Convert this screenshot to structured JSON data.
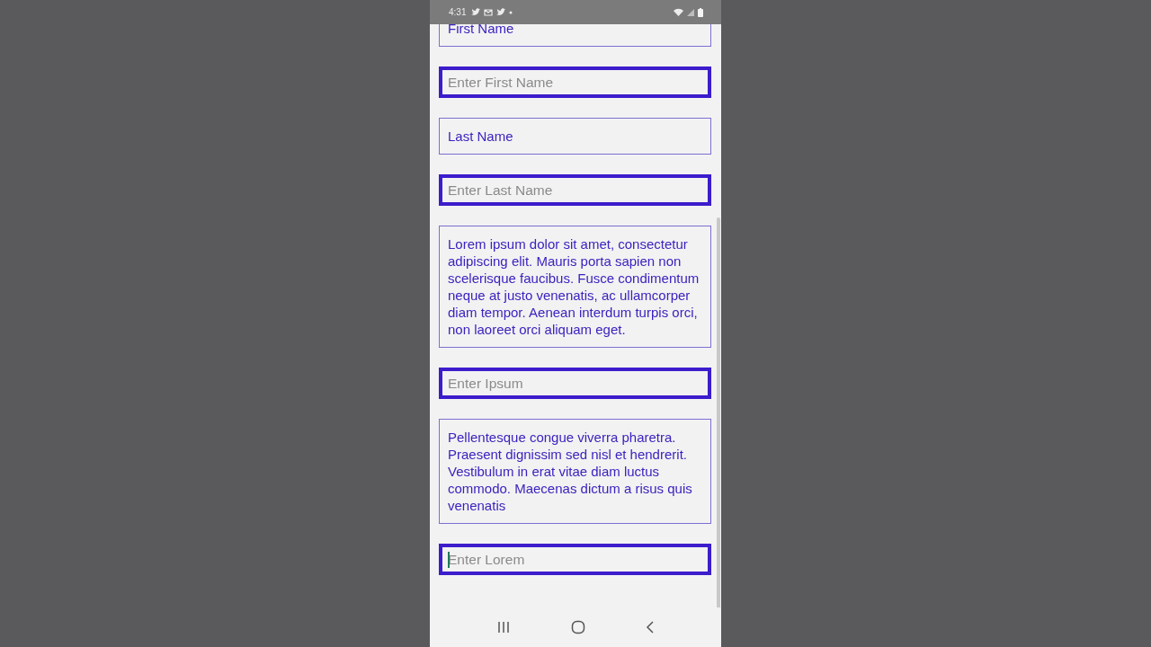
{
  "status_bar": {
    "time": "4:31"
  },
  "form": [
    {
      "kind": "label",
      "text": "First Name"
    },
    {
      "kind": "input",
      "placeholder": "Enter First Name",
      "focused": false
    },
    {
      "kind": "label",
      "text": "Last Name"
    },
    {
      "kind": "input",
      "placeholder": "Enter Last Name",
      "focused": false
    },
    {
      "kind": "label",
      "text": "Lorem ipsum dolor sit amet, consectetur adipiscing elit. Mauris porta sapien non scelerisque faucibus. Fusce condimentum neque at justo venenatis, ac ullamcorper diam tempor. Aenean interdum turpis orci, non laoreet orci aliquam eget."
    },
    {
      "kind": "input",
      "placeholder": "Enter Ipsum",
      "focused": false
    },
    {
      "kind": "label",
      "text": "Pellentesque congue viverra pharetra. Praesent dignissim sed nisl et hendrerit. Vestibulum in erat vitae diam luctus commodo. Maecenas dictum a risus quis venenatis"
    },
    {
      "kind": "input",
      "placeholder": "Enter Lorem",
      "focused": true
    }
  ]
}
